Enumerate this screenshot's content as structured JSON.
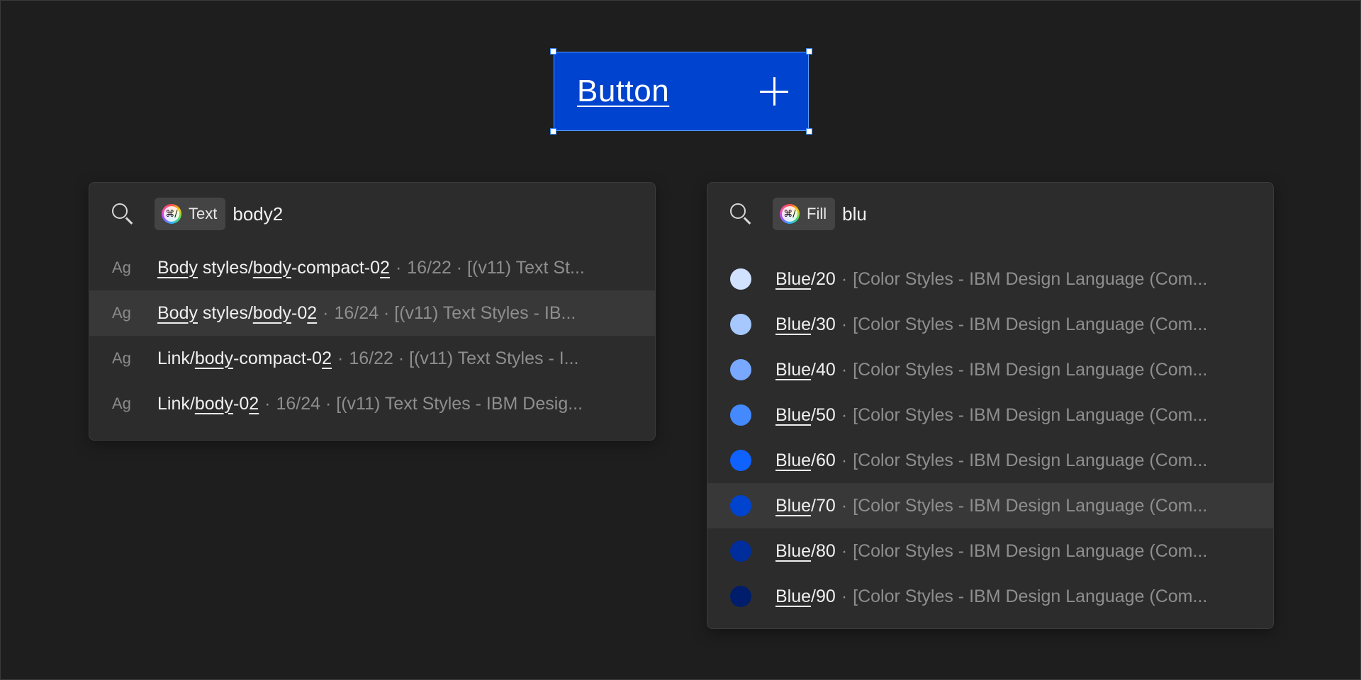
{
  "canvas_button": {
    "label": "Button",
    "icon": "plus-icon",
    "fill": "#0043ce"
  },
  "text_search": {
    "chip_icon": "⌘/",
    "chip_label": "Text",
    "query": "body2",
    "results": [
      {
        "glyph": "Ag",
        "name_parts": [
          {
            "t": "Body",
            "u": true
          },
          {
            "t": " styles/",
            "u": false
          },
          {
            "t": "body",
            "u": true
          },
          {
            "t": "-compact-0",
            "u": false
          },
          {
            "t": "2",
            "u": true
          }
        ],
        "meta": "16/22 · [(v11) Text St...",
        "highlighted": false
      },
      {
        "glyph": "Ag",
        "name_parts": [
          {
            "t": "Body",
            "u": true
          },
          {
            "t": " styles/",
            "u": false
          },
          {
            "t": "body",
            "u": true
          },
          {
            "t": "-0",
            "u": false
          },
          {
            "t": "2",
            "u": true
          }
        ],
        "meta": "16/24 · [(v11) Text Styles - IB...",
        "highlighted": true
      },
      {
        "glyph": "Ag",
        "name_parts": [
          {
            "t": "Link/",
            "u": false
          },
          {
            "t": "body",
            "u": true
          },
          {
            "t": "-compact-0",
            "u": false
          },
          {
            "t": "2",
            "u": true
          }
        ],
        "meta": "16/22 · [(v11) Text Styles - I...",
        "highlighted": false
      },
      {
        "glyph": "Ag",
        "name_parts": [
          {
            "t": "Link/",
            "u": false
          },
          {
            "t": "body",
            "u": true
          },
          {
            "t": "-0",
            "u": false
          },
          {
            "t": "2",
            "u": true
          }
        ],
        "meta": "16/24 · [(v11) Text Styles - IBM Desig...",
        "highlighted": false
      }
    ]
  },
  "fill_search": {
    "chip_icon": "⌘/",
    "chip_label": "Fill",
    "query": "blu",
    "results": [
      {
        "match": "Blue",
        "rest": "/20",
        "meta": "[Color Styles - IBM Design Language (Com...",
        "color": "#d0e2ff",
        "highlighted": false
      },
      {
        "match": "Blue",
        "rest": "/30",
        "meta": "[Color Styles - IBM Design Language (Com...",
        "color": "#a6c8ff",
        "highlighted": false
      },
      {
        "match": "Blue",
        "rest": "/40",
        "meta": "[Color Styles - IBM Design Language (Com...",
        "color": "#78a9ff",
        "highlighted": false
      },
      {
        "match": "Blue",
        "rest": "/50",
        "meta": "[Color Styles - IBM Design Language (Com...",
        "color": "#4589ff",
        "highlighted": false
      },
      {
        "match": "Blue",
        "rest": "/60",
        "meta": "[Color Styles - IBM Design Language (Com...",
        "color": "#0f62fe",
        "highlighted": false
      },
      {
        "match": "Blue",
        "rest": "/70",
        "meta": "[Color Styles - IBM Design Language (Com...",
        "color": "#0043ce",
        "highlighted": true
      },
      {
        "match": "Blue",
        "rest": "/80",
        "meta": "[Color Styles - IBM Design Language (Com...",
        "color": "#002d9c",
        "highlighted": false
      },
      {
        "match": "Blue",
        "rest": "/90",
        "meta": "[Color Styles - IBM Design Language (Com...",
        "color": "#001d6c",
        "highlighted": false
      }
    ]
  }
}
